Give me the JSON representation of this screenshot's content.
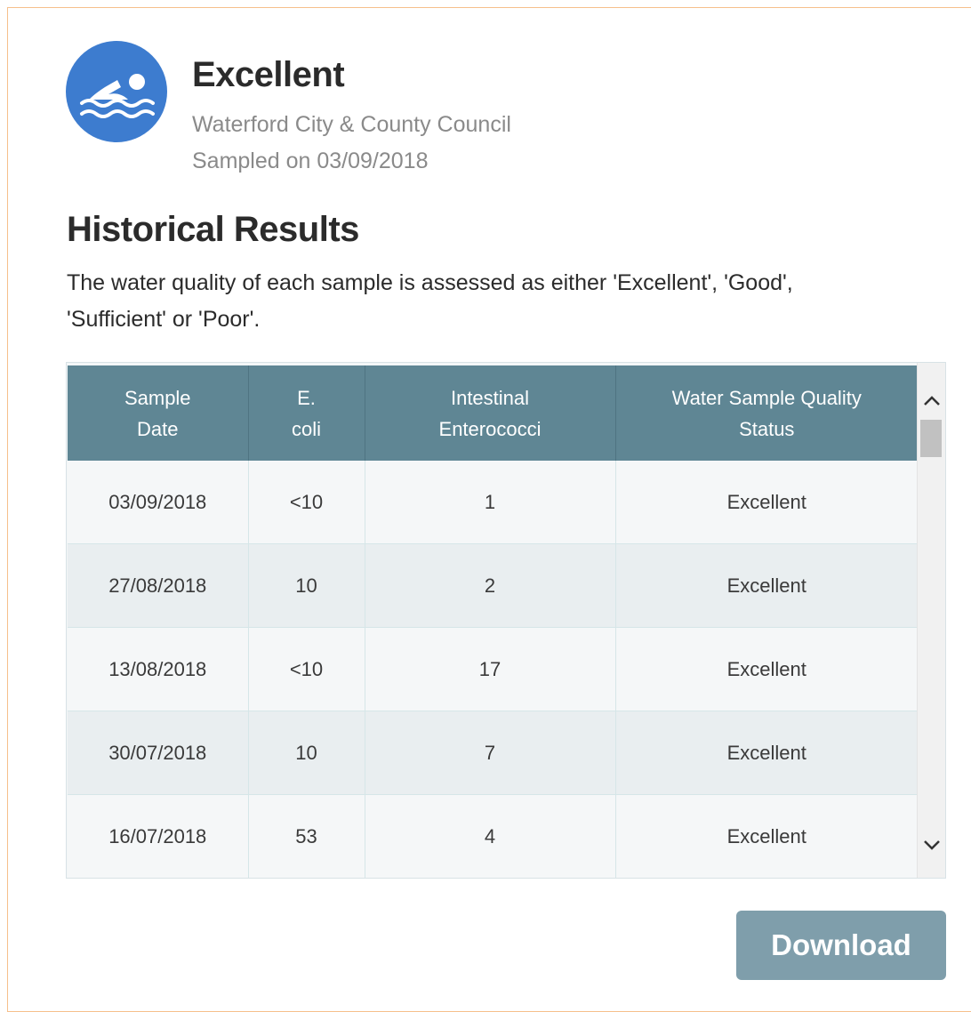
{
  "summary": {
    "icon": "swimmer-icon",
    "status": "Excellent",
    "council": "Waterford City & County Council",
    "sampled": "Sampled on 03/09/2018"
  },
  "history": {
    "title": "Historical Results",
    "description": "The water quality of each sample is assessed as either 'Excellent', 'Good', 'Sufficient' or 'Poor'."
  },
  "table": {
    "headers": [
      "Sample Date",
      "E. coli",
      "Intestinal Enterococci",
      "Water Sample Quality Status"
    ],
    "rows": [
      [
        "03/09/2018",
        "<10",
        "1",
        "Excellent"
      ],
      [
        "27/08/2018",
        "10",
        "2",
        "Excellent"
      ],
      [
        "13/08/2018",
        "<10",
        "17",
        "Excellent"
      ],
      [
        "30/07/2018",
        "10",
        "7",
        "Excellent"
      ],
      [
        "16/07/2018",
        "53",
        "4",
        "Excellent"
      ],
      [
        "",
        "",
        "",
        ""
      ]
    ]
  },
  "actions": {
    "download_label": "Download"
  },
  "colors": {
    "badge": "#3d7ccf",
    "header": "#5f8694",
    "button": "#7f9eab",
    "panel_border": "#f6c08c"
  }
}
